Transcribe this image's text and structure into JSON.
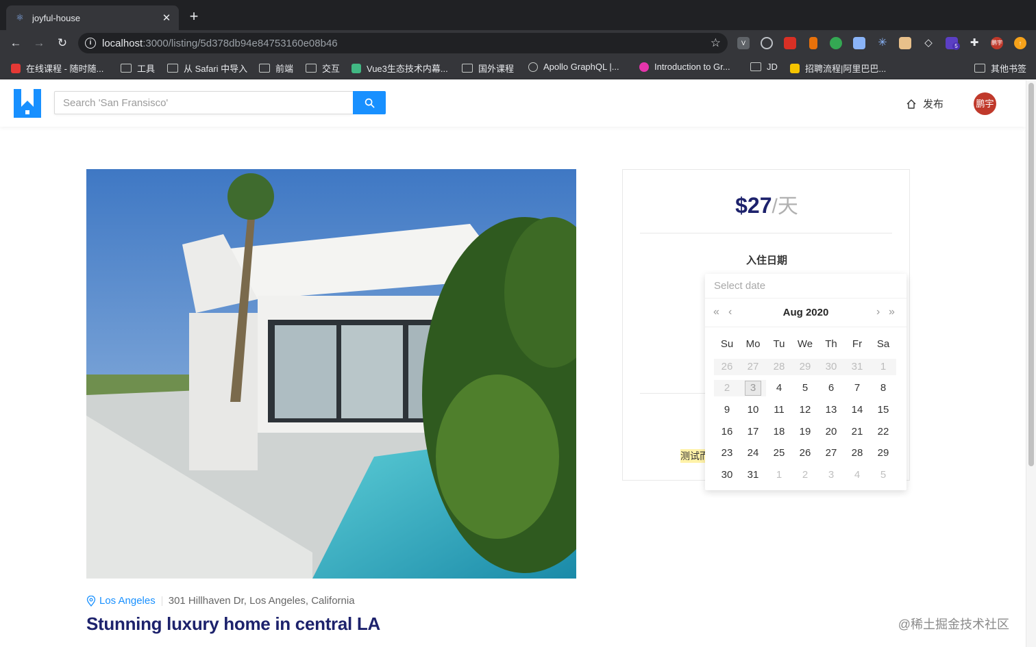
{
  "browser": {
    "tab_title": "joyful-house",
    "url_host": "localhost",
    "url_path": ":3000/listing/5d378db94e84753160e08b46",
    "bookmarks": [
      "在线课程 - 随时随...",
      "工具",
      "从 Safari 中导入",
      "前端",
      "交互",
      "Vue3生态技术内幕...",
      "国外课程",
      "Apollo GraphQL |...",
      "Introduction to Gr...",
      "JD",
      "招聘流程|阿里巴巴...",
      "其他书签"
    ],
    "extension_badge": "5",
    "profile_label": "鹏宇"
  },
  "header": {
    "search_placeholder": "Search 'San Fransisco'",
    "host_label": "发布",
    "avatar_text": "鹏宇"
  },
  "listing": {
    "city": "Los Angeles",
    "address": "301 Hillhaven Dr, Los Angeles, California",
    "title": "Stunning luxury home in central LA"
  },
  "booking": {
    "price": "$27",
    "unit": "/天",
    "checkin_label": "入住日期",
    "highlight_text": "测试而"
  },
  "datepicker": {
    "placeholder": "Select date",
    "month_label": "Aug 2020",
    "weekdays": [
      "Su",
      "Mo",
      "Tu",
      "We",
      "Th",
      "Fr",
      "Sa"
    ],
    "weeks": [
      [
        "26",
        "27",
        "28",
        "29",
        "30",
        "31",
        "1"
      ],
      [
        "2",
        "3",
        "4",
        "5",
        "6",
        "7",
        "8"
      ],
      [
        "9",
        "10",
        "11",
        "12",
        "13",
        "14",
        "15"
      ],
      [
        "16",
        "17",
        "18",
        "19",
        "20",
        "21",
        "22"
      ],
      [
        "23",
        "24",
        "25",
        "26",
        "27",
        "28",
        "29"
      ],
      [
        "30",
        "31",
        "1",
        "2",
        "3",
        "4",
        "5"
      ]
    ]
  },
  "watermark": "@稀土掘金技术社区",
  "colors": {
    "brand_blue": "#1890ff",
    "title_navy": "#1d226c",
    "avatar_red": "#c0392b"
  }
}
